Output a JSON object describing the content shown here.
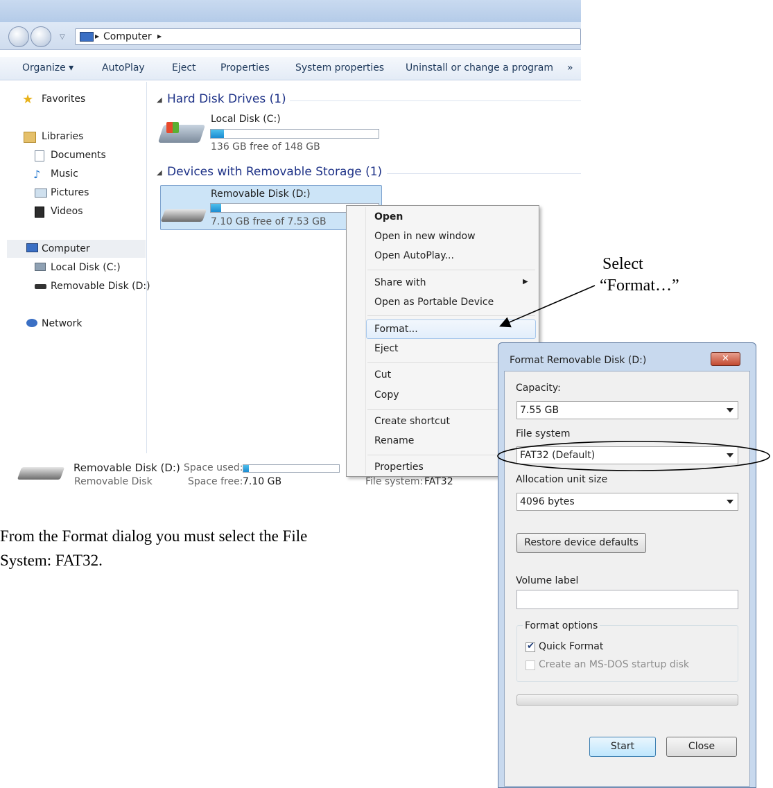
{
  "address": {
    "path": "Computer"
  },
  "toolbar": {
    "items": [
      "Organize ▾",
      "AutoPlay",
      "Eject",
      "Properties",
      "System properties",
      "Uninstall or change a program",
      "»"
    ]
  },
  "nav": {
    "favorites": "Favorites",
    "libraries": "Libraries",
    "documents": "Documents",
    "music": "Music",
    "pictures": "Pictures",
    "videos": "Videos",
    "computer": "Computer",
    "local_disk": "Local Disk (C:)",
    "removable": "Removable Disk (D:)",
    "network": "Network"
  },
  "groups": {
    "hdd": "Hard Disk Drives (1)",
    "removable": "Devices with Removable Storage (1)"
  },
  "drives": {
    "c": {
      "name": "Local Disk (C:)",
      "free": "136 GB free of 148 GB",
      "used_fraction": 0.08
    },
    "d": {
      "name": "Removable Disk (D:)",
      "free": "7.10 GB free of 7.53 GB",
      "used_fraction": 0.06
    }
  },
  "details": {
    "name": "Removable Disk (D:)",
    "type": "Removable Disk",
    "space_used_label": "Space used:",
    "space_free_label": "Space free:",
    "space_free_value": "7.10 GB",
    "fs_label": "File system:",
    "fs_value": "FAT32"
  },
  "context_menu": {
    "open": "Open",
    "open_new": "Open in new window",
    "autoplay": "Open AutoPlay...",
    "share": "Share with",
    "portable": "Open as Portable Device",
    "format": "Format...",
    "eject": "Eject",
    "cut": "Cut",
    "copy": "Copy",
    "shortcut": "Create shortcut",
    "rename": "Rename",
    "properties": "Properties"
  },
  "dialog": {
    "title": "Format Removable Disk (D:)",
    "capacity_label": "Capacity:",
    "capacity_value": "7.55 GB",
    "fs_label": "File system",
    "fs_value": "FAT32 (Default)",
    "alloc_label": "Allocation unit size",
    "alloc_value": "4096 bytes",
    "restore": "Restore device defaults",
    "volume_label": "Volume label",
    "volume_value": "",
    "options_label": "Format options",
    "quick_format": "Quick Format",
    "quick_checked": true,
    "msdos": "Create an MS-DOS startup disk",
    "progress": 0,
    "start": "Start",
    "close": "Close"
  },
  "annotations": {
    "select_line1": "Select",
    "select_line2": "“Format…”",
    "caption": "From the Format dialog you must select the File System: FAT32."
  }
}
